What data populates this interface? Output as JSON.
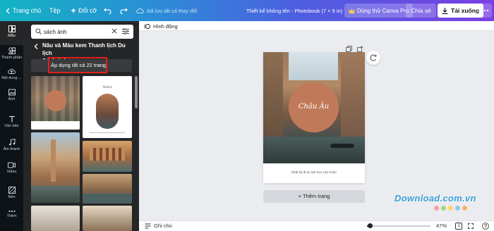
{
  "topbar": {
    "home": "Trang chủ",
    "file": "Tệp",
    "resize": "Đổi cỡ",
    "saved_status": "Đã lưu tất cả thay đổi",
    "design_title": "Thiết kế không tên - Photobook (7 × 9 in)",
    "pro_button": "Dùng thử Canva Pro",
    "share_button": "Chia sẻ",
    "download_button": "Tải xuống"
  },
  "rail": {
    "items": [
      {
        "label": "Mẫu",
        "icon": "template-icon"
      },
      {
        "label": "Thành phần",
        "icon": "elements-icon"
      },
      {
        "label": "Nội dung ...",
        "icon": "upload-icon"
      },
      {
        "label": "Ảnh",
        "icon": "photo-icon"
      },
      {
        "label": "Văn bản",
        "icon": "text-icon"
      },
      {
        "label": "Âm thanh",
        "icon": "music-icon"
      },
      {
        "label": "Video",
        "icon": "video-icon"
      },
      {
        "label": "Nền",
        "icon": "background-icon"
      },
      {
        "label": "Thêm",
        "icon": "more-icon"
      }
    ]
  },
  "panel": {
    "search_value": "sách ảnh",
    "template_title_line1": "Nâu và Màu kem Thanh lịch Du lịch",
    "template_title_line2": "Sách ảnh",
    "apply_button": "Áp dụng tất cả 22 trang",
    "thumb2_label": "Venice"
  },
  "canvas": {
    "animate": "Hình động",
    "page_title": "Châu Âu",
    "caption": "Nhật ký đi du lịch tour của Châu",
    "add_page": "+ Thêm trang"
  },
  "bottombar": {
    "notes": "Ghi chú",
    "zoom": "47%",
    "page_count": "1"
  },
  "watermark": "Download.com.vn",
  "colors": {
    "accent_circle": "#c07a5a",
    "highlight_box": "#e0201c",
    "rail_bg": "#0e1318",
    "panel_bg": "#252627"
  }
}
